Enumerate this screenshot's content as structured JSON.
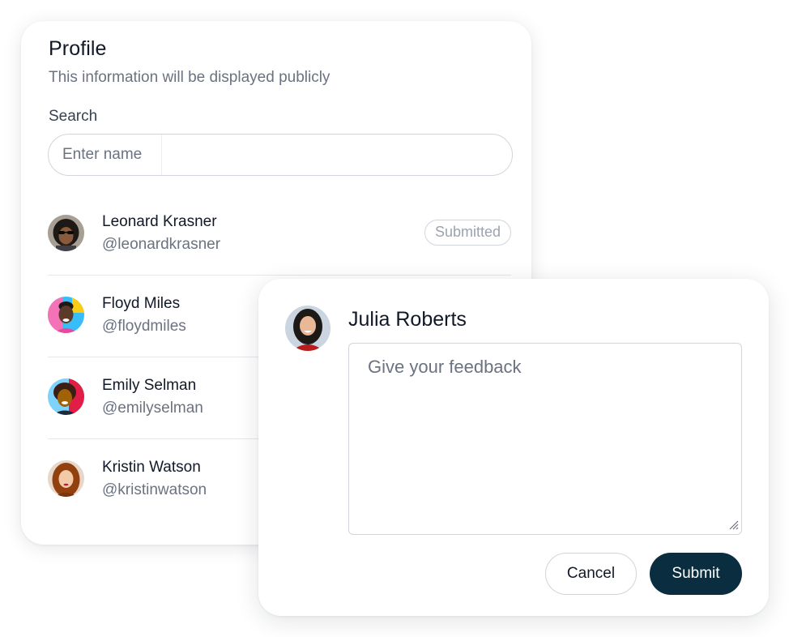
{
  "profile": {
    "title": "Profile",
    "subtitle": "This information will be displayed publicly",
    "search_label": "Search",
    "search_placeholder": "Enter name",
    "search_value": "",
    "users": [
      {
        "name": "Leonard Krasner",
        "handle": "@leonardkrasner",
        "status": "Submitted"
      },
      {
        "name": "Floyd Miles",
        "handle": "@floydmiles"
      },
      {
        "name": "Emily Selman",
        "handle": "@emilyselman"
      },
      {
        "name": "Kristin Watson",
        "handle": "@kristinwatson"
      }
    ]
  },
  "feedback": {
    "name": "Julia Roberts",
    "placeholder": "Give your feedback",
    "value": "",
    "cancel_label": "Cancel",
    "submit_label": "Submit"
  },
  "colors": {
    "primary_button": "#0b2d40",
    "muted_text": "#6b7280",
    "border": "#d1d5db"
  },
  "icons": [
    "resize-grip-icon"
  ]
}
